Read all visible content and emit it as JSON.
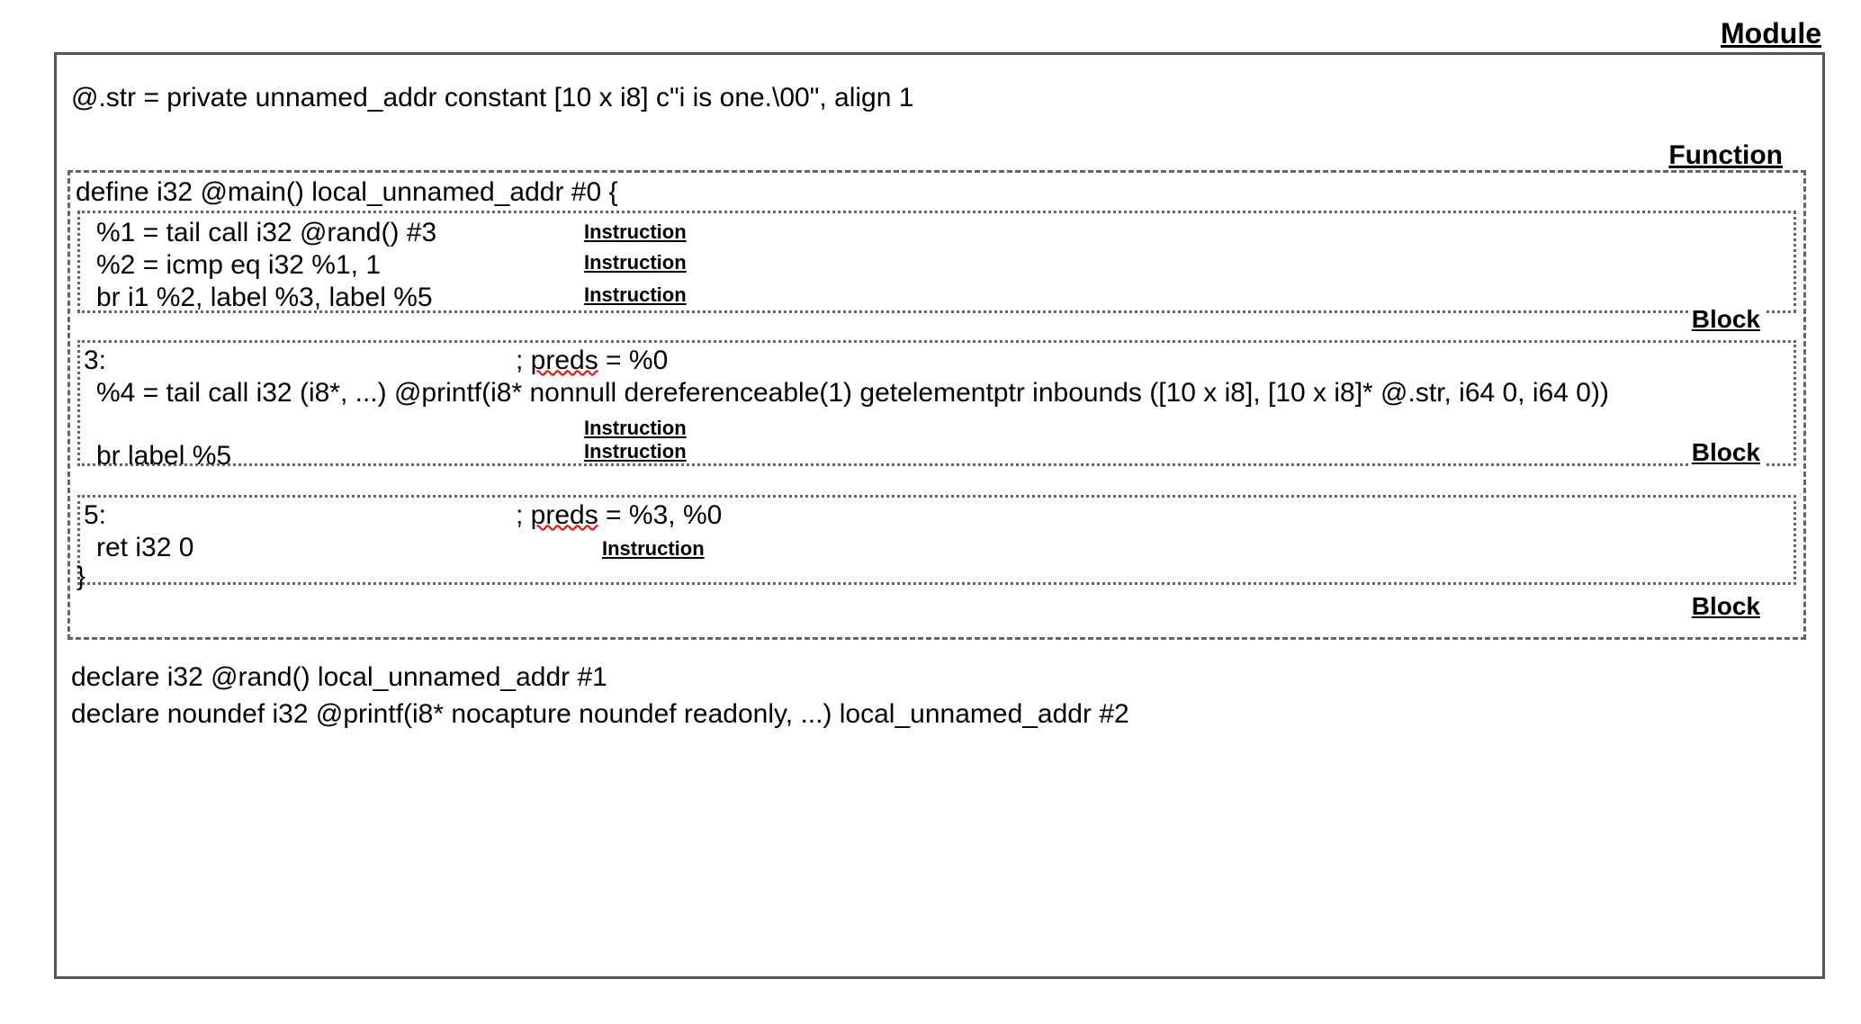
{
  "labels": {
    "module": "Module",
    "function": "Function",
    "block": "Block",
    "instruction": "Instruction"
  },
  "module": {
    "global_str": "@.str = private unnamed_addr constant [10 x i8] c\"i is one.\\00\", align 1",
    "declares": [
      "declare i32 @rand() local_unnamed_addr #1",
      "declare noundef i32 @printf(i8* nocapture noundef readonly, ...) local_unnamed_addr #2"
    ]
  },
  "function": {
    "header": "define i32 @main() local_unnamed_addr #0 {",
    "footer": "}",
    "blocks": [
      {
        "label": null,
        "preds": null,
        "instructions": [
          "%1 = tail call i32 @rand() #3",
          "%2 = icmp eq i32 %1, 1",
          "br i1 %2, label %3, label %5"
        ]
      },
      {
        "label": "3:",
        "preds_prefix": "; ",
        "preds_word": "preds",
        "preds_suffix": " = %0",
        "instructions": [
          "%4 = tail call i32 (i8*, ...) @printf(i8* nonnull dereferenceable(1) getelementptr inbounds ([10 x i8], [10 x i8]* @.str, i64 0, i64 0))",
          "br label %5"
        ]
      },
      {
        "label": "5:",
        "preds_prefix": "; ",
        "preds_word": "preds",
        "preds_suffix": " = %3, %0",
        "instructions": [
          "ret i32 0"
        ]
      }
    ]
  }
}
